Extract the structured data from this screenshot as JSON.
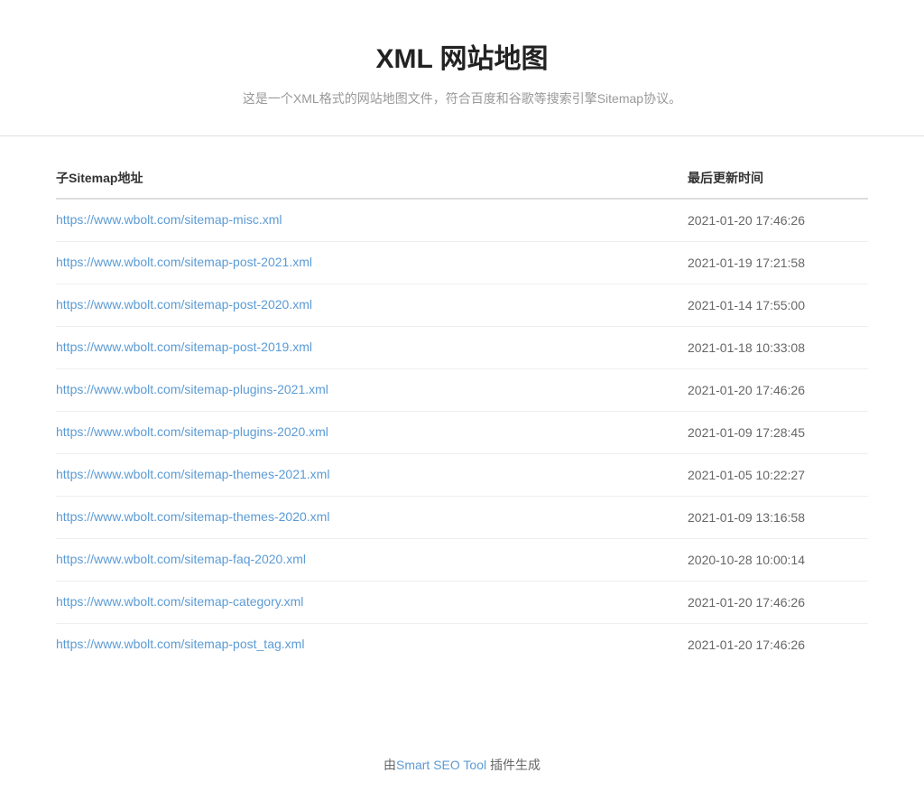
{
  "header": {
    "title": "XML 网站地图",
    "subtitle": "这是一个XML格式的网站地图文件，符合百度和谷歌等搜索引擎Sitemap协议。"
  },
  "table": {
    "col_url_label": "子Sitemap地址",
    "col_date_label": "最后更新时间",
    "rows": [
      {
        "url": "https://www.wbolt.com/sitemap-misc.xml",
        "date": "2021-01-20 17:46:26"
      },
      {
        "url": "https://www.wbolt.com/sitemap-post-2021.xml",
        "date": "2021-01-19 17:21:58"
      },
      {
        "url": "https://www.wbolt.com/sitemap-post-2020.xml",
        "date": "2021-01-14 17:55:00"
      },
      {
        "url": "https://www.wbolt.com/sitemap-post-2019.xml",
        "date": "2021-01-18 10:33:08"
      },
      {
        "url": "https://www.wbolt.com/sitemap-plugins-2021.xml",
        "date": "2021-01-20 17:46:26"
      },
      {
        "url": "https://www.wbolt.com/sitemap-plugins-2020.xml",
        "date": "2021-01-09 17:28:45"
      },
      {
        "url": "https://www.wbolt.com/sitemap-themes-2021.xml",
        "date": "2021-01-05 10:22:27"
      },
      {
        "url": "https://www.wbolt.com/sitemap-themes-2020.xml",
        "date": "2021-01-09 13:16:58"
      },
      {
        "url": "https://www.wbolt.com/sitemap-faq-2020.xml",
        "date": "2020-10-28 10:00:14"
      },
      {
        "url": "https://www.wbolt.com/sitemap-category.xml",
        "date": "2021-01-20 17:46:26"
      },
      {
        "url": "https://www.wbolt.com/sitemap-post_tag.xml",
        "date": "2021-01-20 17:46:26"
      }
    ]
  },
  "footer": {
    "prefix": "由",
    "link_text": "Smart SEO Tool",
    "suffix": " 插件生成",
    "link_url": "https://www.wbolt.com/smart-seo-tool.html"
  }
}
